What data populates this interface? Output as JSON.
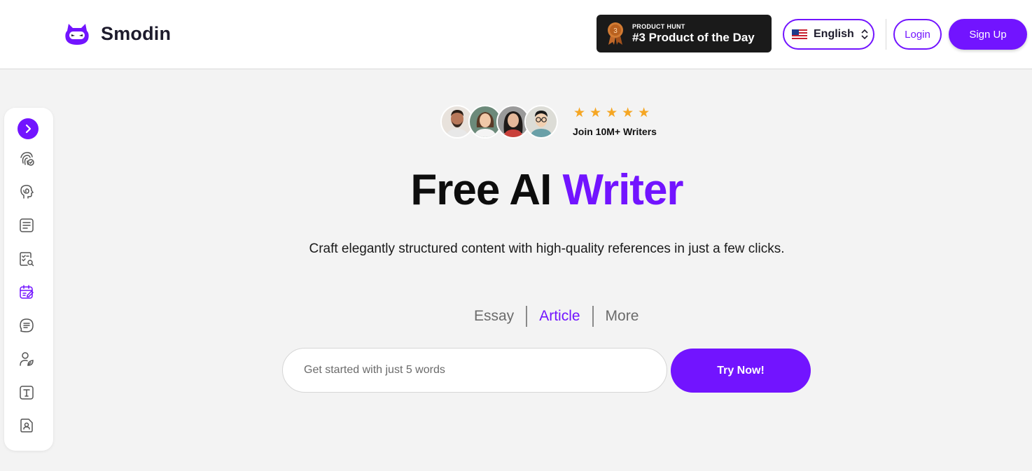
{
  "header": {
    "brand_name": "Smodin",
    "product_hunt": {
      "small_label": "PRODUCT HUNT",
      "big_label": "#3 Product of the Day",
      "medal_number": "3"
    },
    "language": {
      "label": "English",
      "flag_icon": "us-flag-icon"
    },
    "login_label": "Login",
    "signup_label": "Sign Up"
  },
  "sidebar": {
    "expand_icon": "chevron-right-icon",
    "items": [
      {
        "icon": "fingerprint-check-icon"
      },
      {
        "icon": "head-spiral-icon"
      },
      {
        "icon": "document-lines-icon"
      },
      {
        "icon": "document-search-icon"
      },
      {
        "icon": "calendar-edit-icon",
        "active": true
      },
      {
        "icon": "chat-lines-icon"
      },
      {
        "icon": "user-leaf-icon"
      },
      {
        "icon": "text-box-icon"
      },
      {
        "icon": "document-person-icon"
      }
    ]
  },
  "hero": {
    "stars": "★★★★★",
    "join_text": "Join 10M+ Writers",
    "title_part1": "Free AI ",
    "title_accent": "Writer",
    "subtitle": "Craft elegantly structured content with high-quality references in just a few clicks."
  },
  "tabs": [
    {
      "label": "Essay",
      "active": false
    },
    {
      "label": "Article",
      "active": true
    },
    {
      "label": "More",
      "active": false
    }
  ],
  "search": {
    "placeholder": "Get started with just 5 words",
    "value": ""
  },
  "cta_label": "Try Now!",
  "colors": {
    "accent": "#7214ff",
    "star": "#f5a623",
    "background": "#f3f3f3"
  }
}
